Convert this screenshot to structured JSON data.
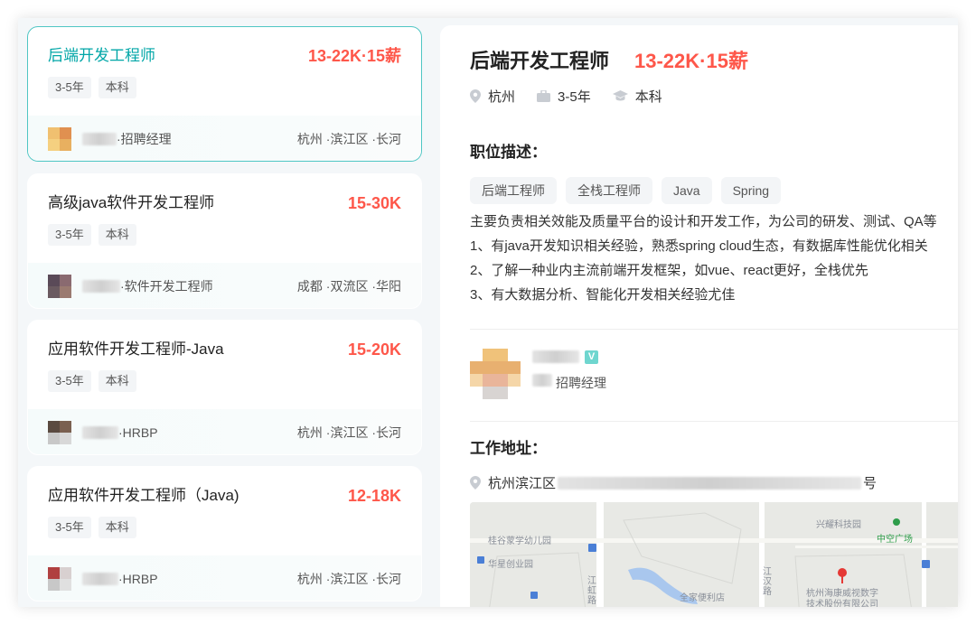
{
  "jobs": [
    {
      "title": "后端开发工程师",
      "salary": "13-22K·15薪",
      "tags": [
        "3-5年",
        "本科"
      ],
      "hr_role": "·招聘经理",
      "location": "杭州 ·滨江区 ·长河"
    },
    {
      "title": "高级java软件开发工程师",
      "salary": "15-30K",
      "tags": [
        "3-5年",
        "本科"
      ],
      "hr_role": "·软件开发工程师",
      "location": "成都 ·双流区 ·华阳"
    },
    {
      "title": "应用软件开发工程师-Java",
      "salary": "15-20K",
      "tags": [
        "3-5年",
        "本科"
      ],
      "hr_role": "·HRBP",
      "location": "杭州 ·滨江区 ·长河"
    },
    {
      "title": "应用软件开发工程师（Java)",
      "salary": "12-18K",
      "tags": [
        "3-5年",
        "本科"
      ],
      "hr_role": "·HRBP",
      "location": "杭州 ·滨江区 ·长河"
    }
  ],
  "detail": {
    "title": "后端开发工程师",
    "salary": "13-22K·15薪",
    "city": "杭州",
    "experience": "3-5年",
    "degree": "本科",
    "desc_heading": "职位描述：",
    "skills": [
      "后端工程师",
      "全栈工程师",
      "Java",
      "Spring"
    ],
    "desc_lines": [
      "主要负责相关效能及质量平台的设计和开发工作，为公司的研发、测试、QA等",
      "1、有java开发知识相关经验，熟悉spring cloud生态，有数据库性能优化相关",
      "2、了解一种业内主流前端开发框架，如vue、react更好，全栈优先",
      "3、有大数据分析、智能化开发相关经验尤佳"
    ],
    "verified_badge": "V",
    "boss_role": "招聘经理",
    "address_heading": "工作地址：",
    "address_prefix": "杭州滨江区",
    "address_suffix": "号"
  },
  "map": {
    "labels": [
      "兴耀科技园",
      "中空广场",
      "桂谷蒙学幼儿园",
      "华星创业园",
      "江虹路",
      "江汉路",
      "全家便利店",
      "杭州海康威视数字",
      "技术股份有限公司"
    ]
  },
  "colors": {
    "accent": "#00a6a7",
    "salary": "#fe574a",
    "active_border": "#4fc6c4"
  }
}
